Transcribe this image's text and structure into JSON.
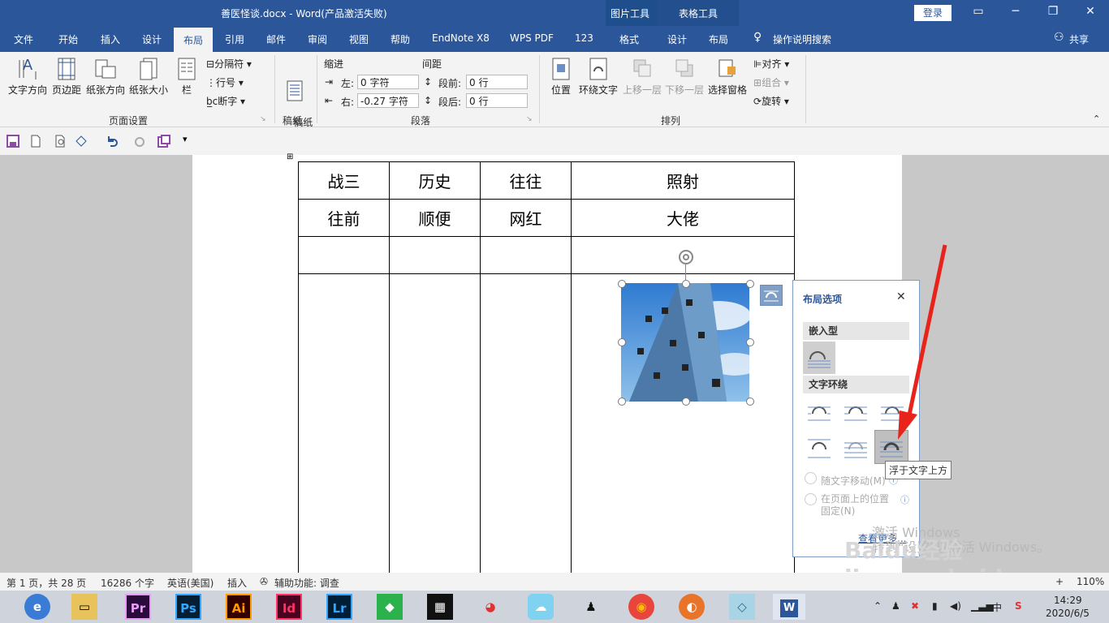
{
  "window": {
    "title": "善医怪谈.docx  -  Word(产品激活失败)",
    "context_headers": [
      "图片工具",
      "表格工具"
    ],
    "login_label": "登录"
  },
  "tabs": [
    "文件",
    "开始",
    "插入",
    "设计",
    "布局",
    "引用",
    "邮件",
    "审阅",
    "视图",
    "帮助",
    "EndNote X8",
    "WPS PDF",
    "123",
    "格式",
    "设计",
    "布局"
  ],
  "active_tab": "布局",
  "tell_me": "操作说明搜索",
  "share_label": "共享",
  "ribbon": {
    "page_setup": {
      "buttons": [
        "文字方向",
        "页边距",
        "纸张方向",
        "纸张大小",
        "栏"
      ],
      "small": [
        "分隔符",
        "行号",
        "断字"
      ],
      "label": "页面设置"
    },
    "manuscript": {
      "button": "稿纸\n设置",
      "label": "稿纸"
    },
    "paragraph": {
      "indent_heading": "缩进",
      "spacing_heading": "间距",
      "left_label": "左:",
      "left_value": "0 字符",
      "right_label": "右:",
      "right_value": "-0.27 字符",
      "before_label": "段前:",
      "before_value": "0 行",
      "after_label": "段后:",
      "after_value": "0 行",
      "label": "段落"
    },
    "arrange": {
      "buttons": [
        "位置",
        "环绕文字",
        "上移一层",
        "下移一层",
        "选择窗格"
      ],
      "small": [
        "对齐",
        "组合",
        "旋转"
      ],
      "label": "排列"
    }
  },
  "table": {
    "rows": [
      [
        "战三",
        "历史",
        "往往",
        "照射"
      ],
      [
        "往前",
        "顺便",
        "网红",
        "大佬"
      ],
      [
        "",
        "",
        "",
        ""
      ],
      [
        "",
        "",
        "",
        ""
      ]
    ]
  },
  "layout_panel": {
    "title": "布局选项",
    "inline_section": "嵌入型",
    "wrap_section": "文字环绕",
    "tooltip": "浮于文字上方",
    "opt_move_with_text": "随文字移动(M)",
    "opt_fix_position": "在页面上的位置\n固定(N)",
    "see_more": "查看更多..."
  },
  "status": {
    "page": "第 1 页，共 28 页",
    "words": "16286 个字",
    "lang": "英语(美国)",
    "mode": "插入",
    "accessibility": "辅助功能: 调查",
    "zoom": "110%"
  },
  "taskbar": {
    "apps": [
      "Pr",
      "Ps",
      "Ai",
      "Id",
      "Lr",
      "W"
    ],
    "time": "14:29",
    "date": "2020/6/5",
    "ime": "中"
  },
  "watermark": "Baidu经验\njingyan.baidu.com",
  "activation_watermark": "激活 Windows\n转到\"设置\"以激活 Windows。",
  "colors": {
    "title_blue": "#2b579a",
    "ribbon_bg": "#f3f3f3",
    "arrow": "#e8231c"
  }
}
